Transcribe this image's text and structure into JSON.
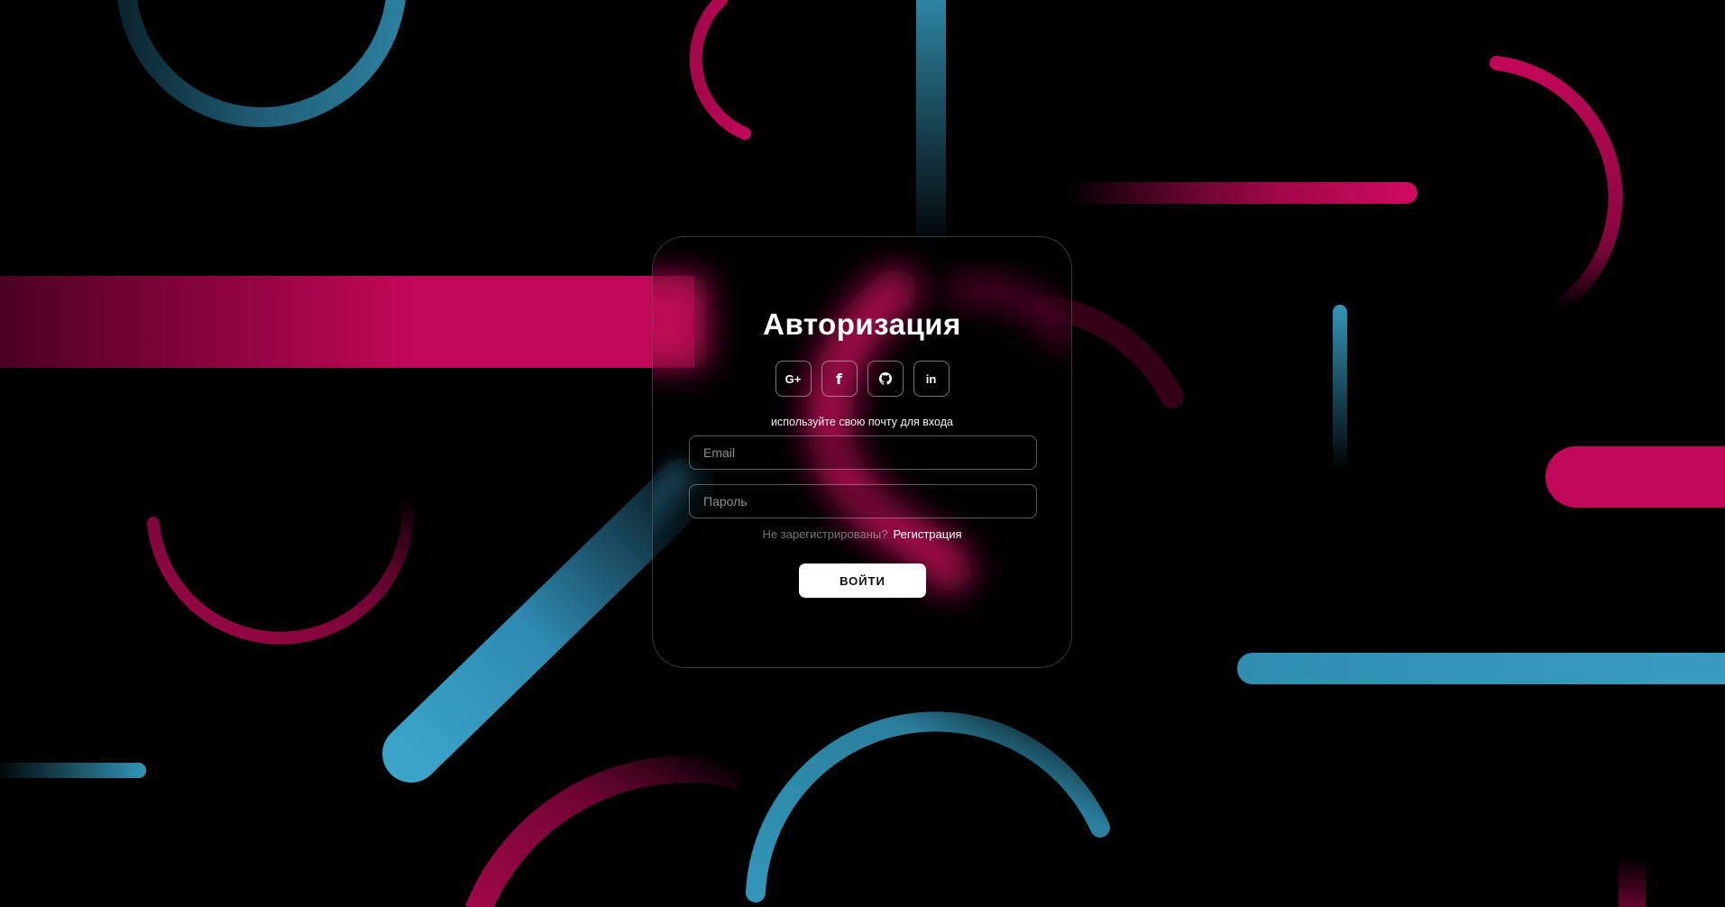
{
  "colors": {
    "background": "#000000",
    "pink": "#c20858",
    "blue": "#3296b8",
    "card_border": "rgba(255,255,255,0.22)",
    "button_bg": "#ffffff",
    "button_text": "#111111"
  },
  "auth": {
    "title": "Авторизация",
    "socials": [
      {
        "icon": "google-plus-icon",
        "label": "G+"
      },
      {
        "icon": "facebook-icon",
        "label": "f"
      },
      {
        "icon": "github-icon",
        "label": ""
      },
      {
        "icon": "linkedin-icon",
        "label": "in"
      }
    ],
    "hint": "используйте свою почту для входа",
    "email_placeholder": "Email",
    "password_placeholder": "Пароль",
    "register_question": "Не зарегистрированы?",
    "register_link": "Регистрация",
    "submit_label": "ВОЙТИ"
  }
}
